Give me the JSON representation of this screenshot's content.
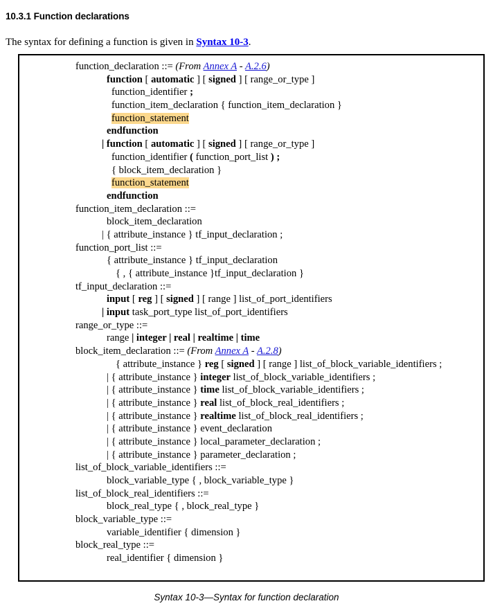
{
  "document": {
    "heading": "10.3.1 Function declarations",
    "intro": {
      "before_link": "The syntax for defining a function is given in ",
      "link_text": "Syntax 10-3",
      "after_link": "."
    },
    "caption": "Syntax 10-3—Syntax for function declaration",
    "link_color": "#0000ee",
    "highlight_color": "#fcd88d",
    "border_color": "#000000"
  },
  "syntax_box": {
    "annotations": {
      "from_label": "(From ",
      "annex_link": "Annex A",
      "dash": " - ",
      "section_a26": "A.2.6",
      "section_a28": "A.2.8",
      "close_paren": ")"
    },
    "lines": [
      {
        "id": "l1",
        "indent": "i0",
        "text": "function_declaration ::= ",
        "note": "a26"
      },
      {
        "id": "l2",
        "indent": "i3",
        "segs": [
          [
            "b",
            "function"
          ],
          [
            "n",
            " [ "
          ],
          [
            "b",
            "automatic"
          ],
          [
            "n",
            " ] [ "
          ],
          [
            "b",
            "signed"
          ],
          [
            "n",
            " ] [ range_or_type ]"
          ]
        ]
      },
      {
        "id": "l3",
        "indent": "i4",
        "segs": [
          [
            "n",
            "function_identifier "
          ],
          [
            "b",
            ";"
          ]
        ]
      },
      {
        "id": "l4",
        "indent": "i4",
        "segs": [
          [
            "n",
            "function_item_declaration { function_item_declaration }"
          ]
        ]
      },
      {
        "id": "l5",
        "indent": "i4",
        "segs": [
          [
            "h",
            "function_statement"
          ]
        ]
      },
      {
        "id": "l6",
        "indent": "i3",
        "segs": [
          [
            "b",
            "endfunction"
          ]
        ]
      },
      {
        "id": "l7",
        "indent": "i2",
        "segs": [
          [
            "b",
            "| function"
          ],
          [
            "n",
            " [ "
          ],
          [
            "b",
            "automatic"
          ],
          [
            "n",
            " ] [ "
          ],
          [
            "b",
            "signed"
          ],
          [
            "n",
            " ] [ range_or_type ]"
          ]
        ]
      },
      {
        "id": "l8",
        "indent": "i4",
        "segs": [
          [
            "n",
            "function_identifier "
          ],
          [
            "b",
            "("
          ],
          [
            "n",
            " function_port_list "
          ],
          [
            "b",
            ")"
          ],
          [
            "n",
            " "
          ],
          [
            "b",
            ";"
          ]
        ]
      },
      {
        "id": "l9",
        "indent": "i4",
        "segs": [
          [
            "n",
            "{ block_item_declaration }"
          ]
        ]
      },
      {
        "id": "l10",
        "indent": "i4",
        "segs": [
          [
            "h",
            "function_statement"
          ]
        ]
      },
      {
        "id": "l11",
        "indent": "i3",
        "segs": [
          [
            "b",
            "endfunction"
          ]
        ]
      },
      {
        "id": "l12",
        "indent": "i0",
        "segs": [
          [
            "n",
            "function_item_declaration ::="
          ]
        ]
      },
      {
        "id": "l13",
        "indent": "i3",
        "segs": [
          [
            "n",
            "block_item_declaration"
          ]
        ]
      },
      {
        "id": "l14",
        "indent": "i2",
        "segs": [
          [
            "n",
            "| { attribute_instance } tf_input_declaration ;"
          ]
        ]
      },
      {
        "id": "l15",
        "indent": "i0",
        "segs": [
          [
            "n",
            "function_port_list ::="
          ]
        ]
      },
      {
        "id": "l16",
        "indent": "i3",
        "segs": [
          [
            "n",
            "{ attribute_instance } tf_input_declaration"
          ]
        ]
      },
      {
        "id": "l17",
        "indent": "i5",
        "segs": [
          [
            "n",
            "{ , { attribute_instance }tf_input_declaration }"
          ]
        ]
      },
      {
        "id": "l18",
        "indent": "i0",
        "segs": [
          [
            "n",
            "tf_input_declaration  ::="
          ]
        ]
      },
      {
        "id": "l19",
        "indent": "i3",
        "segs": [
          [
            "b",
            "input"
          ],
          [
            "n",
            " [ "
          ],
          [
            "b",
            "reg"
          ],
          [
            "n",
            " ] [ "
          ],
          [
            "b",
            "signed"
          ],
          [
            "n",
            " ] [ range ] list_of_port_identifiers"
          ]
        ]
      },
      {
        "id": "l20",
        "indent": "i2",
        "segs": [
          [
            "b",
            "| input"
          ],
          [
            "n",
            " task_port_type list_of_port_identifiers"
          ]
        ]
      },
      {
        "id": "l21",
        "indent": "i0",
        "segs": [
          [
            "n",
            "range_or_type ::="
          ]
        ]
      },
      {
        "id": "l22",
        "indent": "i3",
        "segs": [
          [
            "n",
            "range "
          ],
          [
            "b",
            "| integer | real | realtime | time"
          ]
        ]
      },
      {
        "id": "l23",
        "indent": "i0",
        "text": "block_item_declaration ::= ",
        "note": "a28"
      },
      {
        "id": "l24",
        "indent": "i5",
        "segs": [
          [
            "n",
            "{ attribute_instance } "
          ],
          [
            "b",
            "reg"
          ],
          [
            "n",
            " [ "
          ],
          [
            "b",
            "signed"
          ],
          [
            "n",
            " ] [ range ] list_of_block_variable_identifiers ;"
          ]
        ]
      },
      {
        "id": "l25",
        "indent": "i3",
        "segs": [
          [
            "n",
            "| { attribute_instance } "
          ],
          [
            "b",
            "integer"
          ],
          [
            "n",
            " list_of_block_variable_identifiers ;"
          ]
        ]
      },
      {
        "id": "l26",
        "indent": "i3",
        "segs": [
          [
            "n",
            "| { attribute_instance } "
          ],
          [
            "b",
            "time"
          ],
          [
            "n",
            " list_of_block_variable_identifiers ;"
          ]
        ]
      },
      {
        "id": "l27",
        "indent": "i3",
        "segs": [
          [
            "n",
            "| { attribute_instance } "
          ],
          [
            "b",
            "real"
          ],
          [
            "n",
            " list_of_block_real_identifiers ;"
          ]
        ]
      },
      {
        "id": "l28",
        "indent": "i3",
        "segs": [
          [
            "n",
            "| { attribute_instance } "
          ],
          [
            "b",
            "realtime"
          ],
          [
            "n",
            " list_of_block_real_identifiers ;"
          ]
        ]
      },
      {
        "id": "l29",
        "indent": "i3",
        "segs": [
          [
            "n",
            "| { attribute_instance } event_declaration"
          ]
        ]
      },
      {
        "id": "l30",
        "indent": "i3",
        "segs": [
          [
            "n",
            "| { attribute_instance } local_parameter_declaration ;"
          ]
        ]
      },
      {
        "id": "l31",
        "indent": "i3",
        "segs": [
          [
            "n",
            "| { attribute_instance } parameter_declaration ;"
          ]
        ]
      },
      {
        "id": "l32",
        "indent": "i0",
        "segs": [
          [
            "n",
            "list_of_block_variable_identifiers ::="
          ]
        ]
      },
      {
        "id": "l33",
        "indent": "i3",
        "segs": [
          [
            "n",
            "block_variable_type { , block_variable_type }"
          ]
        ]
      },
      {
        "id": "l34",
        "indent": "i0",
        "segs": [
          [
            "n",
            "list_of_block_real_identifiers ::="
          ]
        ]
      },
      {
        "id": "l35",
        "indent": "i3",
        "segs": [
          [
            "n",
            "block_real_type { , block_real_type }"
          ]
        ]
      },
      {
        "id": "l36",
        "indent": "i0",
        "segs": [
          [
            "n",
            "block_variable_type ::="
          ]
        ]
      },
      {
        "id": "l37",
        "indent": "i3",
        "segs": [
          [
            "n",
            "variable_identifier { dimension }"
          ]
        ]
      },
      {
        "id": "l38",
        "indent": "i0",
        "segs": [
          [
            "n",
            "block_real_type ::="
          ]
        ]
      },
      {
        "id": "l39",
        "indent": "i3",
        "segs": [
          [
            "n",
            "real_identifier { dimension }"
          ]
        ]
      }
    ]
  }
}
